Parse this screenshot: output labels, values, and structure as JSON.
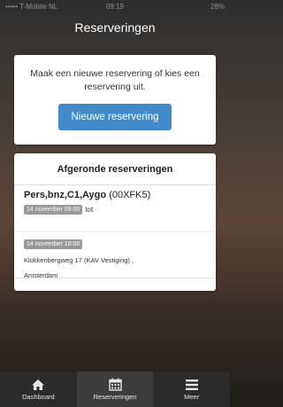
{
  "statusbar": {
    "carrier": "••••• T-Mobile NL",
    "time": "09:19",
    "battery": "28%"
  },
  "navbar": {
    "title": "Reserveringen"
  },
  "new_card": {
    "intro": "Maak een nieuwe reservering of kies een reservering uit.",
    "button_label": "Nieuwe reservering"
  },
  "done_card": {
    "heading": "Afgeronde reserveringen",
    "items": [
      {
        "name": "Pers,bnz,C1,Aygo",
        "plate": "(00XFK5)",
        "start": "14 november 09:00",
        "to_label": "tot",
        "end": "14 november 10:00",
        "address_line1": "Klokkenbergweg 17 (KAV Vestiging) ,",
        "address_line2": "Amsterdam"
      }
    ]
  },
  "tabbar": {
    "tabs": [
      {
        "label": "Dashboard",
        "icon": "home-icon"
      },
      {
        "label": "Reserveringen",
        "icon": "calendar-icon",
        "active": true
      },
      {
        "label": "Meer",
        "icon": "menu-icon"
      }
    ]
  }
}
